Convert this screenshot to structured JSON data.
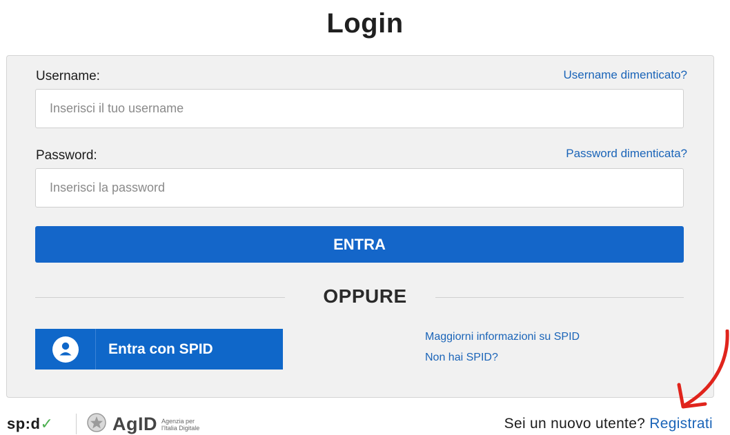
{
  "page": {
    "title": "Login"
  },
  "form": {
    "username_label": "Username:",
    "username_forgot": "Username dimenticato?",
    "username_placeholder": "Inserisci il tuo username",
    "password_label": "Password:",
    "password_forgot": "Password dimenticata?",
    "password_placeholder": "Inserisci la password",
    "submit_label": "ENTRA",
    "separator": "OPPURE"
  },
  "spid": {
    "button_label": "Entra con SPID",
    "more_info_link": "Maggiorni informazioni su SPID",
    "no_spid_link": "Non hai SPID?",
    "icon": "user-circle-icon"
  },
  "footer": {
    "spid_logo_text": "sp:d",
    "agid_logo_text": "AgID",
    "agid_tagline": "Agenzia per l'Italia Digitale",
    "new_user_text": "Sei un nuovo utente?",
    "register_link": "Registrati"
  },
  "colors": {
    "primary": "#1466c9",
    "link": "#1a64b8",
    "panel_bg": "#f1f1f1",
    "annotation": "#e0241c"
  }
}
